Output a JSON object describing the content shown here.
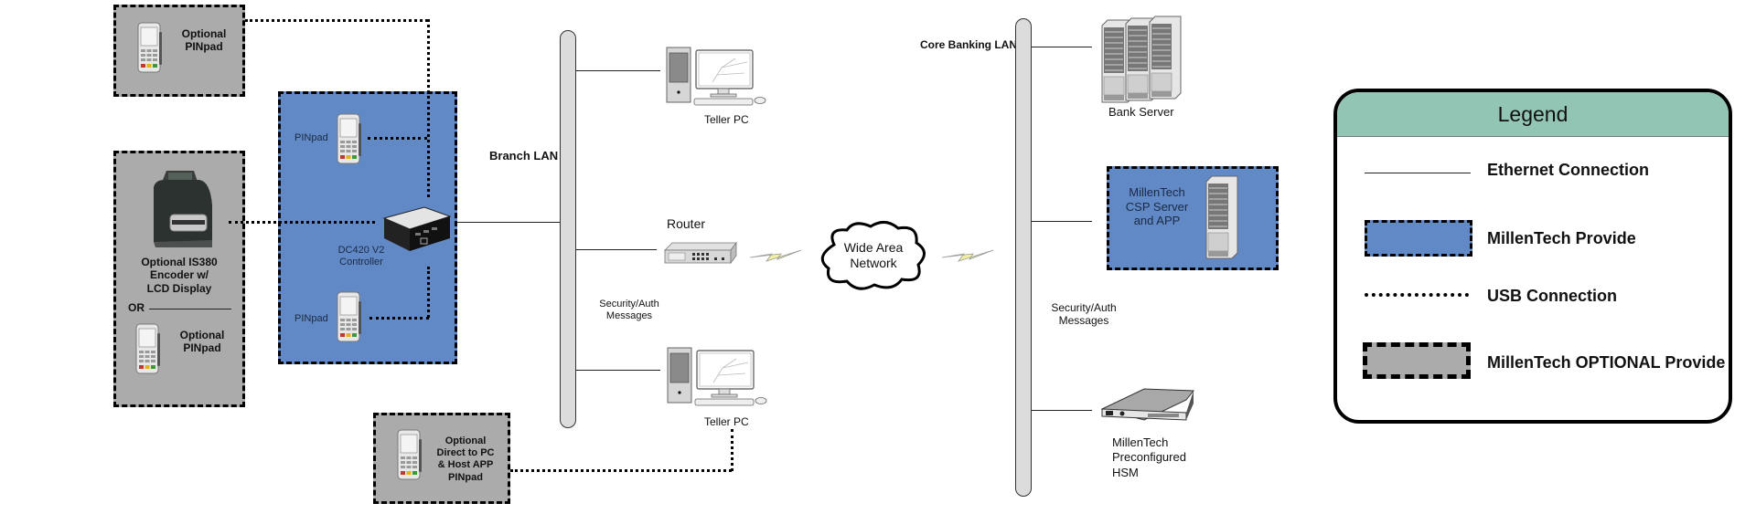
{
  "colors": {
    "provide_fill": "#6189c6",
    "optional_fill": "#ababab",
    "legend_header": "#92c5b3",
    "lan_bar": "#dcdcdc",
    "lightning": "#f0f0a0"
  },
  "left_devices": {
    "optional_pinpad_top": {
      "label_line1": "Optional",
      "label_line2": "PINpad",
      "icon": "pinpad-icon"
    },
    "optional_encoder": {
      "label_line1": "Optional IS380",
      "label_line2": "Encoder w/",
      "label_line3": "LCD Display",
      "icon": "card-encoder-icon",
      "or_label": "OR",
      "alt_label_line1": "Optional",
      "alt_label_line2": "PINpad"
    },
    "optional_direct_pinpad": {
      "label_line1": "Optional",
      "label_line2": "Direct to PC",
      "label_line3": "& Host APP",
      "label_line4": "PINpad",
      "icon": "pinpad-icon"
    }
  },
  "provided_group": {
    "pinpad_top_label": "PINpad",
    "pinpad_bottom_label": "PINpad",
    "controller_line1": "DC420 V2",
    "controller_line2": "Controller",
    "controller_icon": "controller-box-icon"
  },
  "branch_lan": {
    "label": "Branch LAN",
    "messages_line1": "Security/Auth",
    "messages_line2": "Messages",
    "teller_pc_top_label": "Teller PC",
    "teller_pc_bottom_label": "Teller PC",
    "router_label": "Router"
  },
  "wan": {
    "line1": "Wide Area",
    "line2": "Network"
  },
  "core_lan": {
    "label": "Core Banking LAN",
    "messages_line1": "Security/Auth",
    "messages_line2": "Messages",
    "bank_server_label": "Bank Server",
    "csp_line1": "MillenTech",
    "csp_line2": "CSP Server",
    "csp_line3": "and APP",
    "hsm_line1": "MillenTech",
    "hsm_line2": "Preconfigured",
    "hsm_line3": "HSM"
  },
  "legend": {
    "title": "Legend",
    "items": [
      {
        "label": "Ethernet Connection",
        "symbol": "solid-line"
      },
      {
        "label": "MillenTech Provide",
        "symbol": "blue-dashed-box"
      },
      {
        "label": "USB Connection",
        "symbol": "dotted-line"
      },
      {
        "label": "MillenTech OPTIONAL Provide",
        "symbol": "gray-dashed-box"
      }
    ]
  }
}
